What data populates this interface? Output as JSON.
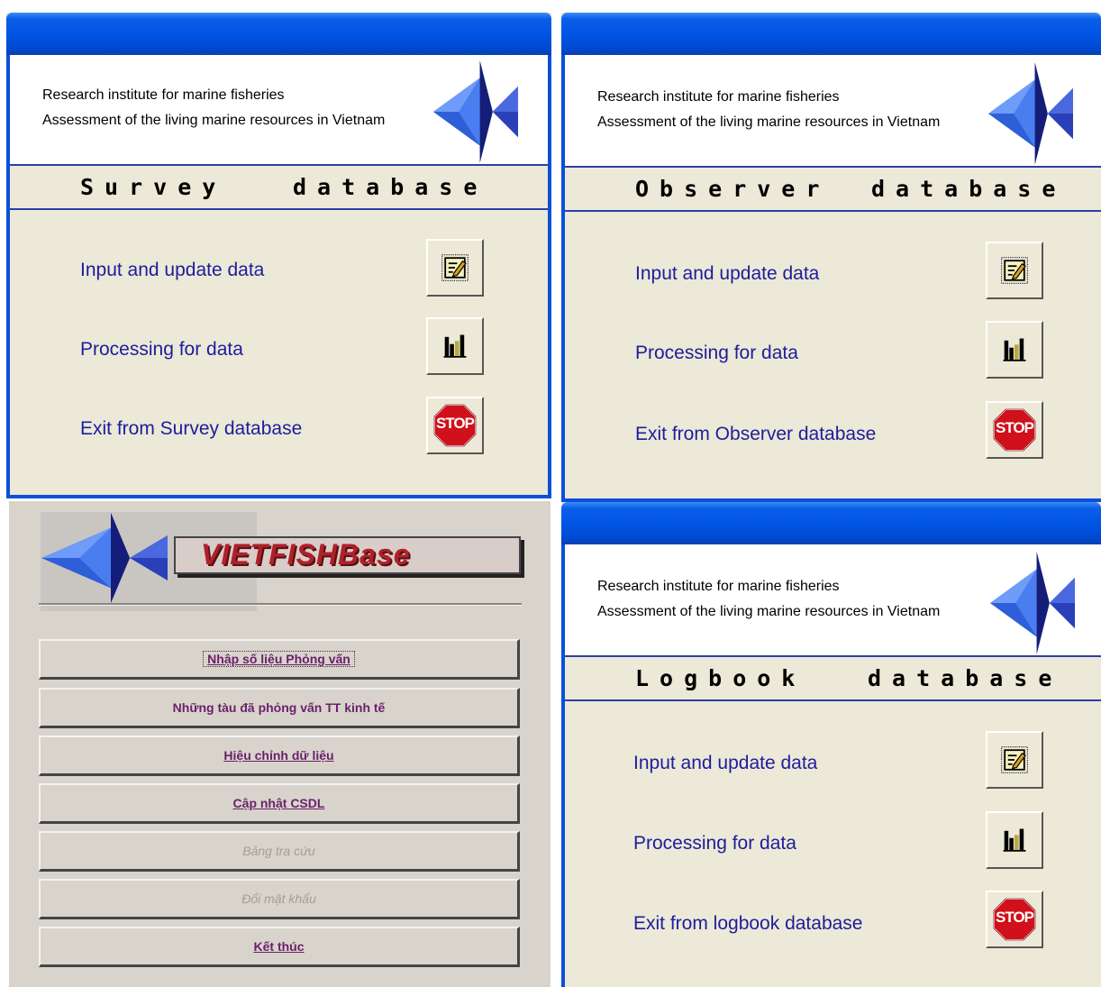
{
  "survey": {
    "institute": "Research institute for marine fisheries",
    "subtitle": "Assessment of the living marine resources in Vietnam",
    "title_word1": "Survey",
    "title_word2": "database",
    "items": [
      {
        "label": "Input and update data",
        "icon": "edit-form-icon"
      },
      {
        "label": "Processing for data",
        "icon": "bar-chart-icon"
      },
      {
        "label": "Exit from Survey database",
        "icon": "stop-sign-icon"
      }
    ]
  },
  "observer": {
    "institute": "Research institute for marine fisheries",
    "subtitle": "Assessment of the living marine resources in Vietnam",
    "title_word1": "Observer",
    "title_word2": "database",
    "items": [
      {
        "label": "Input and update data",
        "icon": "edit-form-icon"
      },
      {
        "label": "Processing for data",
        "icon": "bar-chart-icon"
      },
      {
        "label": "Exit from Observer database",
        "icon": "stop-sign-icon"
      }
    ]
  },
  "logbook": {
    "institute": "Research institute for marine fisheries",
    "subtitle": "Assessment of the living marine resources in Vietnam",
    "title_word1": "Logbook",
    "title_word2": "database",
    "items": [
      {
        "label": "Input and update data",
        "icon": "edit-form-icon"
      },
      {
        "label": "Processing for data",
        "icon": "bar-chart-icon"
      },
      {
        "label": "Exit from logbook database",
        "icon": "stop-sign-icon"
      }
    ]
  },
  "vietfish": {
    "banner": "VIETFISHBase",
    "buttons": [
      {
        "label": "Nhập số liệu Phỏng vấn",
        "enabled": true
      },
      {
        "label": "Những tàu đã phỏng vấn TT kinh tế",
        "enabled": true
      },
      {
        "label": "Hiệu chỉnh dữ liệu",
        "enabled": true
      },
      {
        "label": "Cập nhật CSDL",
        "enabled": true
      },
      {
        "label": "Bảng tra cứu",
        "enabled": false
      },
      {
        "label": "Đổi mật khẩu",
        "enabled": false
      },
      {
        "label": "Kết thúc",
        "enabled": true
      }
    ],
    "stop_text": "STOP"
  },
  "colors": {
    "title_blue": "#0054e3",
    "menu_text": "#1d1d9c",
    "panel_bg": "#ece9d8",
    "stop_red": "#d0101a",
    "banner_red": "#b0202b"
  }
}
